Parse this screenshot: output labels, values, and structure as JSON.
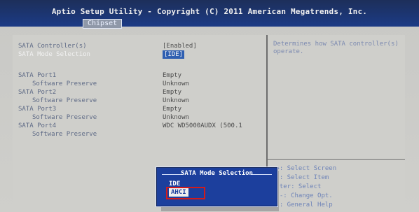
{
  "header": {
    "title": "Aptio Setup Utility - Copyright (C) 2011 American Megatrends, Inc.",
    "tab": "Chipset"
  },
  "settings": {
    "rows": [
      {
        "label": "SATA Controller(s)",
        "value": "[Enabled]"
      },
      {
        "label": "SATA Mode Selection",
        "value": "[IDE]"
      },
      {
        "label": "SATA Port1",
        "value": "Empty"
      },
      {
        "label": "Software Preserve",
        "value": "Unknown"
      },
      {
        "label": "SATA Port2",
        "value": "Empty"
      },
      {
        "label": "Software Preserve",
        "value": "Unknown"
      },
      {
        "label": "SATA Port3",
        "value": "Empty"
      },
      {
        "label": "Software Preserve",
        "value": "Unknown"
      },
      {
        "label": "SATA Port4",
        "value": "WDC WD5000AUDX (500.1"
      },
      {
        "label": "Software Preserve",
        "value": ""
      }
    ]
  },
  "help": {
    "description": "Determines how SATA controller(s) operate.",
    "keys": [
      "←→: Select Screen",
      "↑↓: Select Item",
      "Enter: Select",
      "+/-: Change Opt.",
      "F1: General Help"
    ]
  },
  "dialog": {
    "title": "SATA Mode Selection",
    "options": [
      "IDE",
      "AHCI"
    ]
  }
}
